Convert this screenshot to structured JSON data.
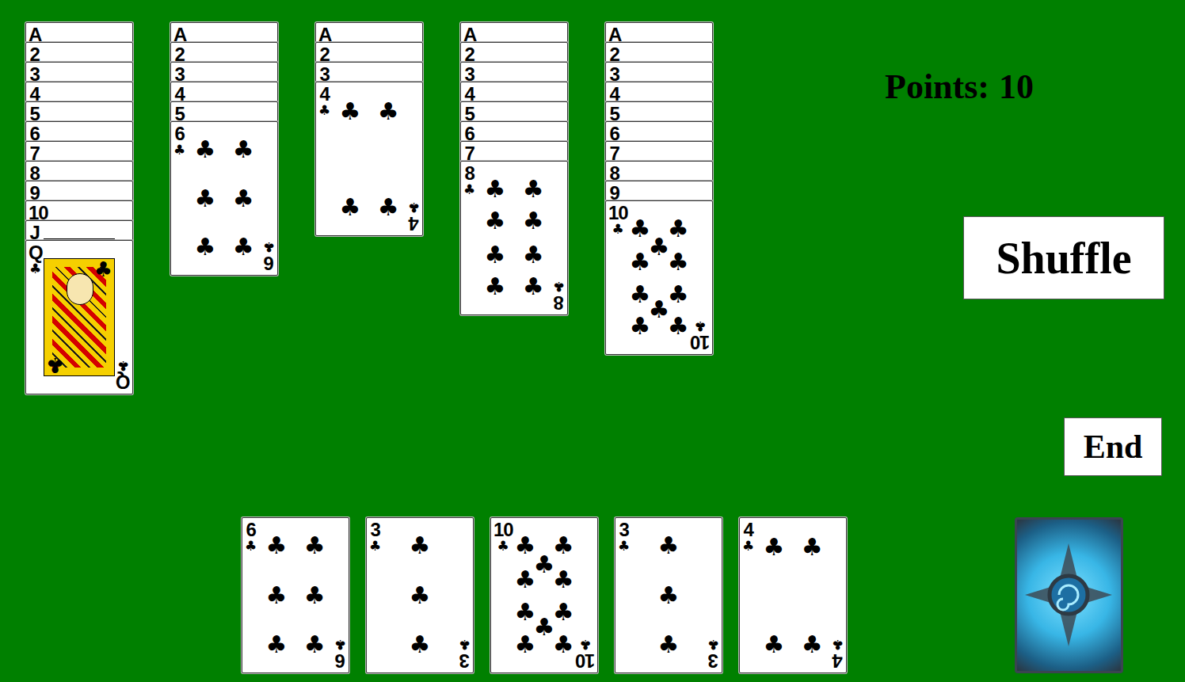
{
  "score": {
    "label": "Points:",
    "value": "10"
  },
  "tableau": [
    {
      "cards": [
        {
          "rank": "A",
          "suit": "♣",
          "kind": "number"
        },
        {
          "rank": "2",
          "suit": "♣",
          "kind": "number"
        },
        {
          "rank": "3",
          "suit": "♣",
          "kind": "number"
        },
        {
          "rank": "4",
          "suit": "♣",
          "kind": "number"
        },
        {
          "rank": "5",
          "suit": "♣",
          "kind": "number"
        },
        {
          "rank": "6",
          "suit": "♣",
          "kind": "number"
        },
        {
          "rank": "7",
          "suit": "♣",
          "kind": "number"
        },
        {
          "rank": "8",
          "suit": "♣",
          "kind": "number"
        },
        {
          "rank": "9",
          "suit": "♣",
          "kind": "number"
        },
        {
          "rank": "10",
          "suit": "♣",
          "kind": "number"
        },
        {
          "rank": "J",
          "suit": "♣",
          "kind": "face"
        },
        {
          "rank": "Q",
          "suit": "♣",
          "kind": "face"
        }
      ]
    },
    {
      "cards": [
        {
          "rank": "A",
          "suit": "♣",
          "kind": "number"
        },
        {
          "rank": "2",
          "suit": "♣",
          "kind": "number"
        },
        {
          "rank": "3",
          "suit": "♣",
          "kind": "number"
        },
        {
          "rank": "4",
          "suit": "♣",
          "kind": "number"
        },
        {
          "rank": "5",
          "suit": "♣",
          "kind": "number"
        },
        {
          "rank": "6",
          "suit": "♣",
          "kind": "number"
        }
      ]
    },
    {
      "cards": [
        {
          "rank": "A",
          "suit": "♣",
          "kind": "number"
        },
        {
          "rank": "2",
          "suit": "♣",
          "kind": "number"
        },
        {
          "rank": "3",
          "suit": "♣",
          "kind": "number"
        },
        {
          "rank": "4",
          "suit": "♣",
          "kind": "number"
        }
      ]
    },
    {
      "cards": [
        {
          "rank": "A",
          "suit": "♣",
          "kind": "number"
        },
        {
          "rank": "2",
          "suit": "♣",
          "kind": "number"
        },
        {
          "rank": "3",
          "suit": "♣",
          "kind": "number"
        },
        {
          "rank": "4",
          "suit": "♣",
          "kind": "number"
        },
        {
          "rank": "5",
          "suit": "♣",
          "kind": "number"
        },
        {
          "rank": "6",
          "suit": "♣",
          "kind": "number"
        },
        {
          "rank": "7",
          "suit": "♣",
          "kind": "number"
        },
        {
          "rank": "8",
          "suit": "♣",
          "kind": "number"
        }
      ]
    },
    {
      "cards": [
        {
          "rank": "A",
          "suit": "♣",
          "kind": "number"
        },
        {
          "rank": "2",
          "suit": "♣",
          "kind": "number"
        },
        {
          "rank": "3",
          "suit": "♣",
          "kind": "number"
        },
        {
          "rank": "4",
          "suit": "♣",
          "kind": "number"
        },
        {
          "rank": "5",
          "suit": "♣",
          "kind": "number"
        },
        {
          "rank": "6",
          "suit": "♣",
          "kind": "number"
        },
        {
          "rank": "7",
          "suit": "♣",
          "kind": "number"
        },
        {
          "rank": "8",
          "suit": "♣",
          "kind": "number"
        },
        {
          "rank": "9",
          "suit": "♣",
          "kind": "number"
        },
        {
          "rank": "10",
          "suit": "♣",
          "kind": "number"
        }
      ]
    }
  ],
  "hand": [
    {
      "rank": "6",
      "suit": "♣",
      "kind": "number"
    },
    {
      "rank": "3",
      "suit": "♣",
      "kind": "number"
    },
    {
      "rank": "10",
      "suit": "♣",
      "kind": "number"
    },
    {
      "rank": "3",
      "suit": "♣",
      "kind": "number"
    },
    {
      "rank": "4",
      "suit": "♣",
      "kind": "number"
    }
  ],
  "buttons": {
    "shuffle": "Shuffle",
    "end": "End"
  },
  "deck": {
    "face_up": false
  }
}
